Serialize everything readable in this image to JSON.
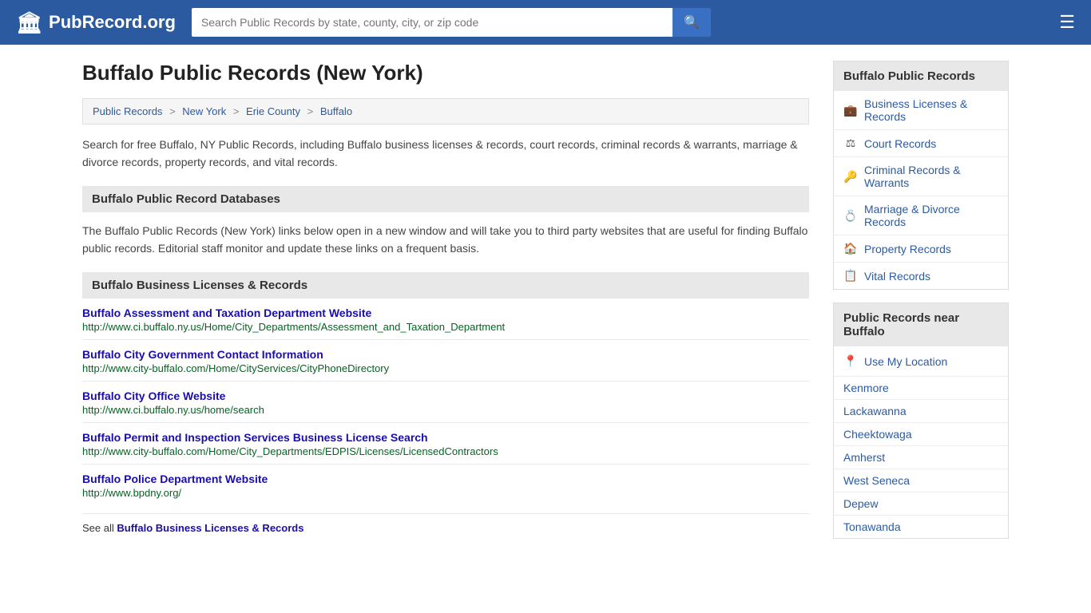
{
  "header": {
    "logo_text": "PubRecord.org",
    "logo_icon": "🏛",
    "search_placeholder": "Search Public Records by state, county, city, or zip code",
    "search_button_icon": "🔍",
    "menu_icon": "☰"
  },
  "page": {
    "title": "Buffalo Public Records (New York)",
    "breadcrumb": [
      {
        "label": "Public Records",
        "href": "#"
      },
      {
        "label": "New York",
        "href": "#"
      },
      {
        "label": "Erie County",
        "href": "#"
      },
      {
        "label": "Buffalo",
        "href": "#"
      }
    ],
    "intro": "Search for free Buffalo, NY Public Records, including Buffalo business licenses & records, court records, criminal records & warrants, marriage & divorce records, property records, and vital records.",
    "databases_heading": "Buffalo Public Record Databases",
    "databases_description": "The Buffalo Public Records (New York) links below open in a new window and will take you to third party websites that are useful for finding Buffalo public records. Editorial staff monitor and update these links on a frequent basis.",
    "category_heading": "Buffalo Business Licenses & Records",
    "records": [
      {
        "title": "Buffalo Assessment and Taxation Department Website",
        "url": "http://www.ci.buffalo.ny.us/Home/City_Departments/Assessment_and_Taxation_Department"
      },
      {
        "title": "Buffalo City Government Contact Information",
        "url": "http://www.city-buffalo.com/Home/CityServices/CityPhoneDirectory"
      },
      {
        "title": "Buffalo City Office Website",
        "url": "http://www.ci.buffalo.ny.us/home/search"
      },
      {
        "title": "Buffalo Permit and Inspection Services Business License Search",
        "url": "http://www.city-buffalo.com/Home/City_Departments/EDPIS/Licenses/LicensedContractors"
      },
      {
        "title": "Buffalo Police Department Website",
        "url": "http://www.bpdny.org/"
      }
    ],
    "see_all_text": "See all ",
    "see_all_link_text": "Buffalo Business Licenses & Records",
    "see_all_href": "#"
  },
  "sidebar": {
    "records_title": "Buffalo Public Records",
    "links": [
      {
        "label": "Business Licenses & Records",
        "icon": "💼",
        "href": "#"
      },
      {
        "label": "Court Records",
        "icon": "⚖",
        "href": "#"
      },
      {
        "label": "Criminal Records & Warrants",
        "icon": "🔑",
        "href": "#"
      },
      {
        "label": "Marriage & Divorce Records",
        "icon": "💍",
        "href": "#"
      },
      {
        "label": "Property Records",
        "icon": "🏠",
        "href": "#"
      },
      {
        "label": "Vital Records",
        "icon": "📋",
        "href": "#"
      }
    ],
    "nearby_title": "Public Records near Buffalo",
    "use_my_location": "Use My Location",
    "nearby_cities": [
      "Kenmore",
      "Lackawanna",
      "Cheektowaga",
      "Amherst",
      "West Seneca",
      "Depew",
      "Tonawanda"
    ]
  }
}
